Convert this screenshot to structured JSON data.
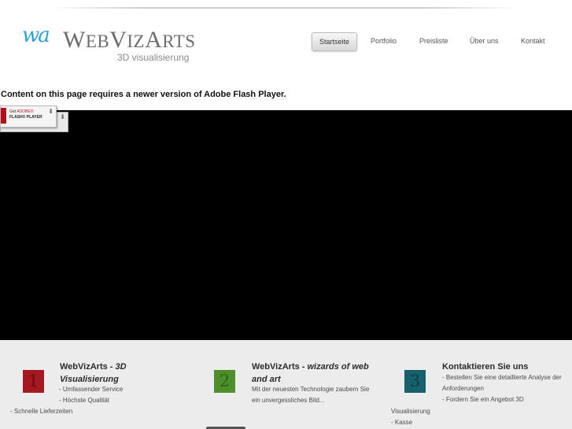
{
  "header": {
    "logo_mark": "wa",
    "logo_name_w": "W",
    "logo_name_eb": "EB",
    "logo_name_v": "V",
    "logo_name_iz": "IZ",
    "logo_name_a": "A",
    "logo_name_rts": "RTS",
    "tagline": "3D visualisierung"
  },
  "nav": {
    "items": [
      {
        "label": "Startseite",
        "active": true
      },
      {
        "label": "Portfolio"
      },
      {
        "label": "Preisliste"
      },
      {
        "label": "Über uns"
      },
      {
        "label": "Kontakt"
      }
    ]
  },
  "flash": {
    "message": "Content on this page requires a newer version of Adobe Flash Player.",
    "badge_get": "Get",
    "badge_adobe": "ADOBE®",
    "badge_player": "FLASH® PLAYER"
  },
  "columns": [
    {
      "number": "1",
      "title_plain": "WebVizArts - ",
      "title_italic": "3D Visualisierung",
      "lines": [
        "- Umfassender Service",
        "- Höchste Qualität",
        "- Schnelle Lieferzeiten"
      ]
    },
    {
      "number": "2",
      "title_plain": "WebVizArts - ",
      "title_italic": "wizards of web and art",
      "lines": [
        "Mit der neuesten Technologie zaubern Sie",
        "ein unvergessliches Bild..."
      ]
    },
    {
      "number": "3",
      "title_plain": "Kontaktieren Sie uns",
      "lines": [
        "- Bestellen Sie eine detaillierte Analyse der",
        "Anforderungen",
        "- Fordern Sie ein Angebot 3D",
        "Visualisierung",
        "- Kasse"
      ]
    }
  ],
  "colors": {
    "accent_red": "#a3191f",
    "accent_green": "#4f8f2b",
    "accent_teal": "#17616d",
    "logo_blue": "#2f9fd8"
  }
}
